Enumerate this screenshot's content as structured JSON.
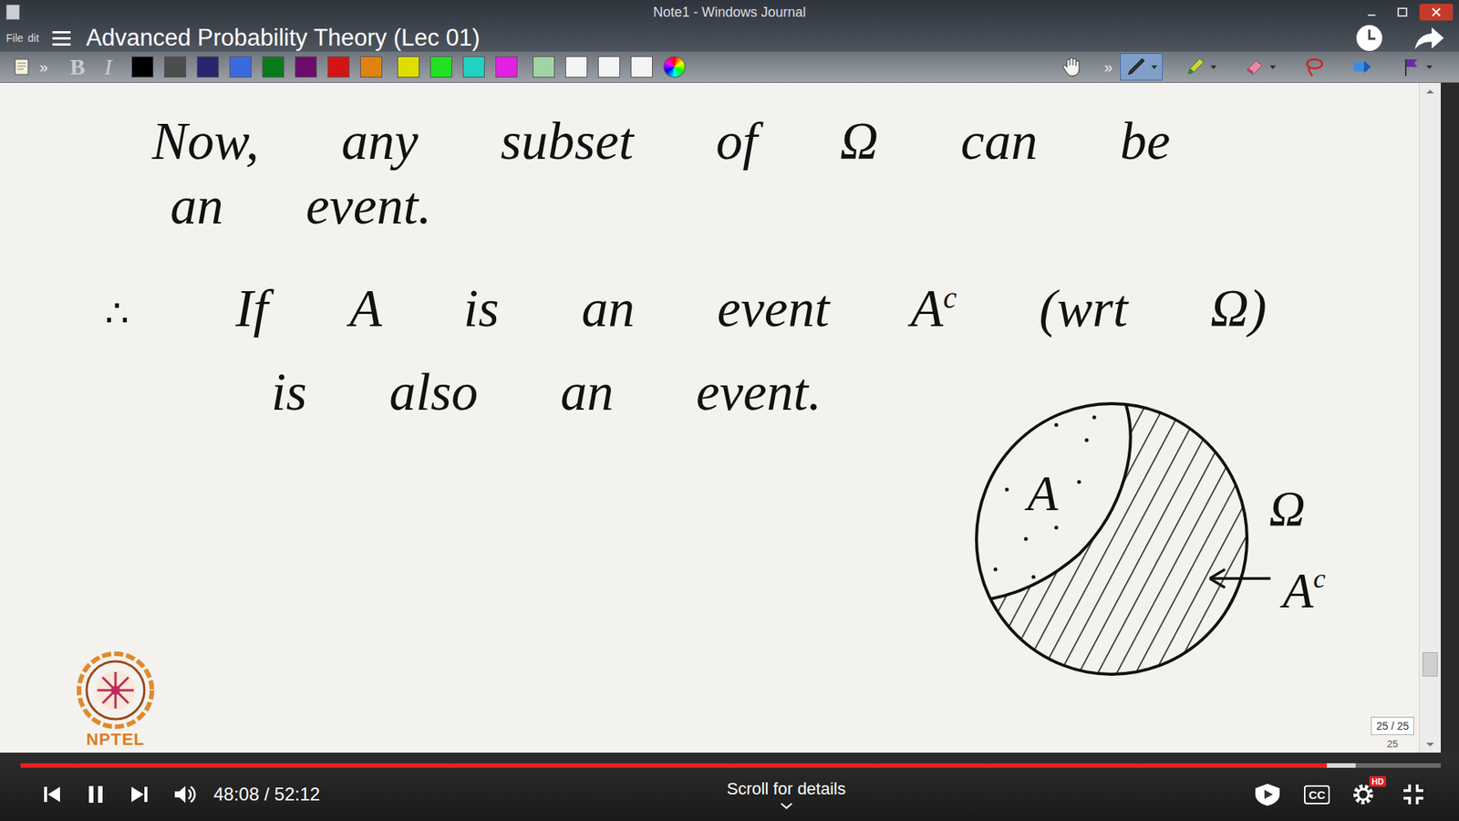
{
  "player": {
    "title": "Advanced Probability Theory (Lec 01)",
    "time": "48:08 / 52:12",
    "progress": 0.92,
    "buffered": 0.94,
    "playing": true,
    "scroll_hint": "Scroll for details",
    "cc_label": "CC",
    "quality_badge": "HD"
  },
  "window": {
    "title": "Note1 - Windows Journal",
    "menu": [
      "File",
      "dit"
    ]
  },
  "toolbar": {
    "more": "»",
    "bold": "B",
    "italic": "I",
    "colors": [
      {
        "color": "#000000"
      },
      {
        "color": "#4d4d4d"
      },
      {
        "color": "#27276f"
      },
      {
        "color": "#3a6ae0"
      },
      {
        "color": "#0b7a1c"
      },
      {
        "color": "#6c0c6c"
      },
      {
        "color": "#d41414"
      },
      {
        "color": "#e0820f"
      },
      {
        "color": "#dede00"
      },
      {
        "color": "#22e022"
      },
      {
        "color": "#1fd2c2"
      },
      {
        "color": "#e021e0"
      },
      {
        "color": "#a3d3a3"
      },
      {
        "color": "#f4f4f4"
      },
      {
        "color": "#f4f4f4"
      },
      {
        "color": "#f4f4f4"
      }
    ],
    "tools": [
      {
        "kind": "hand",
        "selected": false,
        "dropdown": false
      },
      {
        "kind": "pen",
        "selected": true,
        "dropdown": true
      },
      {
        "kind": "highlighter",
        "selected": false,
        "dropdown": true
      },
      {
        "kind": "eraser",
        "selected": false,
        "dropdown": true
      },
      {
        "kind": "lasso",
        "selected": false,
        "dropdown": false
      },
      {
        "kind": "insert",
        "selected": false,
        "dropdown": false
      },
      {
        "kind": "flag",
        "selected": false,
        "dropdown": true
      }
    ]
  },
  "page": {
    "lines": [
      [
        {
          "text": "Now, any subset of Ω can be",
          "kind": "word"
        }
      ],
      [
        {
          "text": "an event.",
          "kind": "word"
        }
      ],
      [
        {
          "text": "∴",
          "kind": "mark"
        },
        {
          "text": "If A is an event A",
          "kind": "word"
        },
        {
          "text": "c",
          "kind": "sup"
        },
        {
          "text": " (wrt Ω)",
          "kind": "word"
        }
      ],
      [
        {
          "text": "is also an event.",
          "kind": "word"
        }
      ]
    ],
    "diagram": {
      "set_label": "A",
      "universe_label": "Ω",
      "complement_label": "A",
      "complement_sup": "c"
    },
    "counter": "25 / 25",
    "thumb_label": "25",
    "scroll_level": 0.95
  },
  "logo": {
    "text": "NPTEL"
  }
}
